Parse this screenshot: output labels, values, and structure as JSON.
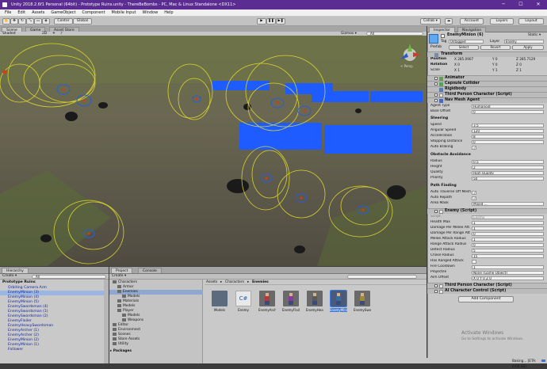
{
  "window": {
    "title": "Unity 2018.2.6f1 Personal (64bit) - Prototype Ruins.unity - ThereBeBombs - PC, Mac & Linux Standalone <DX11>",
    "minimize": "─",
    "maximize": "☐",
    "close": "✕"
  },
  "menu": [
    "File",
    "Edit",
    "Assets",
    "GameObject",
    "Component",
    "Mobile Input",
    "Window",
    "Help"
  ],
  "toolbar": {
    "pivot_center": "Center",
    "pivot_space": "Global",
    "collab": "Collab ▾",
    "account": "Account",
    "layers": "Layers",
    "layout": "Layout"
  },
  "scene_tabs": [
    {
      "label": "Scene"
    },
    {
      "label": "Game"
    },
    {
      "label": "Asset Store"
    }
  ],
  "scene_toolbar": {
    "shading": "Shaded",
    "mode2d": "2D",
    "gizmos": "Gizmos ▾",
    "search": "All"
  },
  "scene_view": {
    "persp_label": "< Persp"
  },
  "hierarchy": {
    "tab": "Hierarchy",
    "create": "Create ▾",
    "search": "All",
    "scene": "Prototype Ruins",
    "items": [
      {
        "label": "Orbiting Camera Arm"
      },
      {
        "label": "EnemyMinion (3)"
      },
      {
        "label": "EnemyMinion (4)"
      },
      {
        "label": "EnemyMinion (5)"
      },
      {
        "label": "EnemySwordsman (4)"
      },
      {
        "label": "EnemySwordsman (1)"
      },
      {
        "label": "EnemySwordsman (2)"
      },
      {
        "label": "EnemyFlailer"
      },
      {
        "label": "EnemyHeavySwordsman"
      },
      {
        "label": "EnemyArcher (1)"
      },
      {
        "label": "EnemyArcher (2)"
      },
      {
        "label": "EnemyMinion (2)"
      },
      {
        "label": "EnemyMinion (1)"
      },
      {
        "label": "Follower"
      }
    ]
  },
  "project": {
    "tabs": [
      "Project",
      "Console"
    ],
    "create": "Create ▾",
    "tree": [
      {
        "label": "Characters",
        "indent": 0
      },
      {
        "label": "Armor",
        "indent": 1
      },
      {
        "label": "Enemies",
        "indent": 1,
        "selected": true
      },
      {
        "label": "Models",
        "indent": 2
      },
      {
        "label": "Materials",
        "indent": 1
      },
      {
        "label": "Models",
        "indent": 1
      },
      {
        "label": "Player",
        "indent": 1
      },
      {
        "label": "Models",
        "indent": 2
      },
      {
        "label": "Weapons",
        "indent": 2
      },
      {
        "label": "Editor",
        "indent": 0
      },
      {
        "label": "Environment",
        "indent": 0
      },
      {
        "label": "Scenes",
        "indent": 0
      },
      {
        "label": "Store Assets",
        "indent": 0
      },
      {
        "label": "Utility",
        "indent": 0
      },
      {
        "label": "Packages",
        "indent": -1
      }
    ],
    "breadcrumb": [
      "Assets",
      "Characters",
      "Enemies"
    ],
    "assets": [
      {
        "label": "Models",
        "kind": "folder"
      },
      {
        "label": "Enemy",
        "kind": "script"
      },
      {
        "label": "EnemyArch...",
        "kind": "prefab"
      },
      {
        "label": "EnemyFlail...",
        "kind": "prefab"
      },
      {
        "label": "EnemyHea...",
        "kind": "prefab"
      },
      {
        "label": "EnemyMini...",
        "kind": "prefab",
        "selected": true
      },
      {
        "label": "EnemySwor...",
        "kind": "prefab"
      }
    ]
  },
  "inspector": {
    "tabs": [
      "Inspector",
      "Navigation"
    ],
    "object_name": "EnemyMinion (6)",
    "static_label": "Static ▾",
    "tag_label": "Tag",
    "tag_value": "Untagged",
    "layer_label": "Layer",
    "layer_value": "Enemy",
    "prefab_label": "Prefab",
    "prefab_select": "Select",
    "prefab_revert": "Revert",
    "prefab_apply": "Apply",
    "transform": {
      "title": "Transform",
      "rows": [
        {
          "label": "Position",
          "x": "X 285.0907",
          "y": "Y 0",
          "z": "Z 285.7129"
        },
        {
          "label": "Rotation",
          "x": "X 0",
          "y": "Y 0",
          "z": "Z 0"
        },
        {
          "label": "Scale",
          "x": "X 1",
          "y": "Y 1",
          "z": "Z 1"
        }
      ]
    },
    "components": [
      {
        "label": "Animator"
      },
      {
        "label": "Capsule Collider"
      },
      {
        "label": "Rigidbody"
      },
      {
        "label": "Third Person Character (Script)"
      },
      {
        "label": "Nav Mesh Agent"
      }
    ],
    "nav_mesh": {
      "agent_type": {
        "label": "Agent Type",
        "value": "Humanoid"
      },
      "base_offset": {
        "label": "Base Offset",
        "value": "0"
      },
      "steering_title": "Steering",
      "steering": [
        {
          "label": "Speed",
          "value": "3.5"
        },
        {
          "label": "Angular Speed",
          "value": "120"
        },
        {
          "label": "Acceleration",
          "value": "8"
        },
        {
          "label": "Stopping Distance",
          "value": "0"
        },
        {
          "label": "Auto Braking",
          "value": "✓"
        }
      ],
      "avoid_title": "Obstacle Avoidance",
      "avoid": [
        {
          "label": "Radius",
          "value": "0.5"
        },
        {
          "label": "Height",
          "value": "2"
        },
        {
          "label": "Quality",
          "value": "High Quality"
        },
        {
          "label": "Priority",
          "value": "50"
        }
      ],
      "path_title": "Path Finding",
      "path": [
        {
          "label": "Auto Traverse Off Mesh",
          "value": "✓"
        },
        {
          "label": "Auto Repath",
          "value": "✓"
        },
        {
          "label": "Area Mask",
          "value": "Mixed ..."
        }
      ]
    },
    "enemy_script": {
      "title": "Enemy (Script)",
      "rows": [
        {
          "label": "Script",
          "value": "Enemy"
        },
        {
          "label": "Health Max",
          "value": "1"
        },
        {
          "label": "Damage Per Melee Att",
          "value": "1"
        },
        {
          "label": "Damage Per Range Att",
          "value": "0"
        },
        {
          "label": "Melee Attack Radius",
          "value": "1"
        },
        {
          "label": "Range Attack Radius",
          "value": "0"
        },
        {
          "label": "Detect Radius",
          "value": "5"
        },
        {
          "label": "Chase Radius",
          "value": "15"
        },
        {
          "label": "Has Ranged Attack",
          "value": ""
        },
        {
          "label": "Fire Cooldown",
          "value": "1"
        },
        {
          "label": "Projectile",
          "value": "None (Game Object)"
        },
        {
          "label": "Aim Offset",
          "value": "X 0    Y 0    Z 0"
        }
      ]
    },
    "components_after": [
      {
        "label": "Third Person Character (Script)"
      },
      {
        "label": "AI Character Control (Script)"
      }
    ],
    "add_component": "Add Component"
  },
  "watermark": {
    "title": "Activate Windows",
    "sub": "Go to Settings to activate Windows."
  },
  "status": {
    "baking": "Baking... [ETA: 0:02:33]"
  },
  "colors": {
    "title_bar": "#5b2c91",
    "nav_blue": "#1e5cff",
    "gizmo_yellow": "#e6e02a",
    "selection": "#3d7ad8"
  }
}
